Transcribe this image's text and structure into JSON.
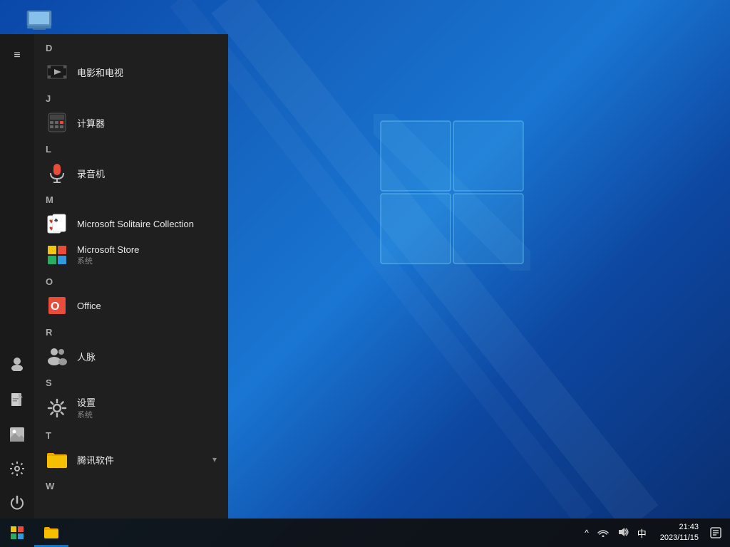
{
  "desktop": {
    "bg_color_start": "#0a47a9",
    "bg_color_end": "#0a2d6e",
    "icon": {
      "label": "此电脑",
      "name": "this-pc"
    }
  },
  "start_menu": {
    "hamburger_icon": "≡",
    "sections": [
      {
        "letter": "D",
        "apps": [
          {
            "name": "电影和电视",
            "sub": "",
            "icon": "film",
            "icon_char": "🎬"
          }
        ]
      },
      {
        "letter": "J",
        "apps": [
          {
            "name": "计算器",
            "sub": "",
            "icon": "calculator",
            "icon_char": "🧮"
          }
        ]
      },
      {
        "letter": "L",
        "apps": [
          {
            "name": "录音机",
            "sub": "",
            "icon": "microphone",
            "icon_char": "🎙"
          }
        ]
      },
      {
        "letter": "M",
        "apps": [
          {
            "name": "Microsoft Solitaire Collection",
            "sub": "",
            "icon": "cards",
            "icon_char": "🃏"
          },
          {
            "name": "Microsoft Store",
            "sub": "系统",
            "icon": "store",
            "icon_char": "🛍"
          }
        ]
      },
      {
        "letter": "O",
        "apps": [
          {
            "name": "Office",
            "sub": "",
            "icon": "office",
            "icon_char": "📄"
          }
        ]
      },
      {
        "letter": "R",
        "apps": [
          {
            "name": "人脉",
            "sub": "",
            "icon": "people",
            "icon_char": "👥"
          }
        ]
      },
      {
        "letter": "S",
        "apps": [
          {
            "name": "设置",
            "sub": "系统",
            "icon": "settings",
            "icon_char": "⚙"
          }
        ]
      },
      {
        "letter": "T",
        "apps": [
          {
            "name": "腾讯软件",
            "sub": "",
            "icon": "folder",
            "icon_char": "📁",
            "has_arrow": true
          }
        ]
      },
      {
        "letter": "W",
        "apps": []
      }
    ],
    "sidebar_icons": [
      {
        "name": "user-icon",
        "char": "👤"
      },
      {
        "name": "document-icon",
        "char": "📄"
      },
      {
        "name": "photos-icon",
        "char": "🖼"
      },
      {
        "name": "settings-icon",
        "char": "⚙"
      },
      {
        "name": "power-icon",
        "char": "⏻"
      }
    ]
  },
  "taskbar": {
    "start_icon": "⊞",
    "file_explorer_icon": "📁",
    "tray": {
      "expand_label": "^",
      "network_label": "🌐",
      "volume_label": "🔊",
      "ime_label": "中",
      "time": "21:43",
      "date": "2023/11/15",
      "notification_label": "🗨"
    }
  }
}
